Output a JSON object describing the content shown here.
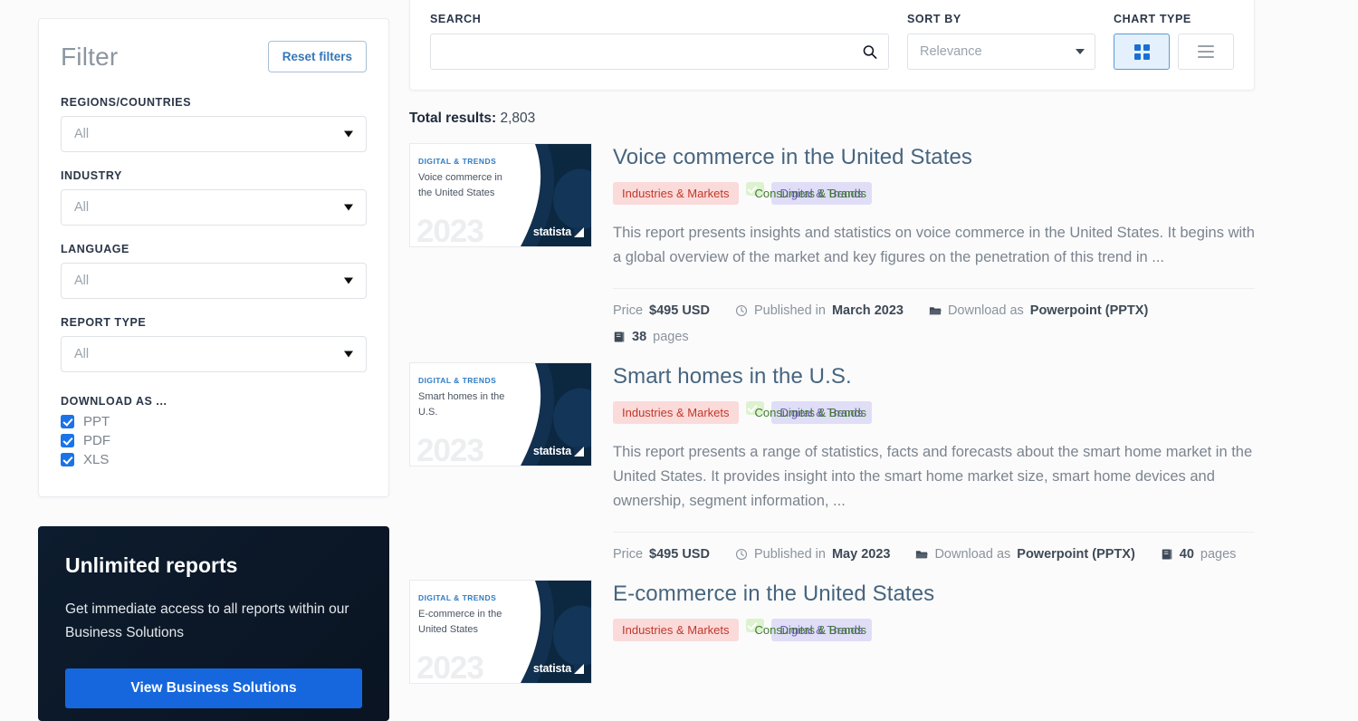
{
  "sidebar": {
    "filter_title": "Filter",
    "reset_label": "Reset filters",
    "groups": [
      {
        "label": "REGIONS/COUNTRIES",
        "value": "All"
      },
      {
        "label": "INDUSTRY",
        "value": "All"
      },
      {
        "label": "LANGUAGE",
        "value": "All"
      },
      {
        "label": "REPORT TYPE",
        "value": "All"
      }
    ],
    "download_as": {
      "title": "DOWNLOAD AS ...",
      "options": [
        {
          "label": "PPT",
          "checked": true
        },
        {
          "label": "PDF",
          "checked": true
        },
        {
          "label": "XLS",
          "checked": true
        }
      ]
    },
    "promo": {
      "title": "Unlimited reports",
      "text": "Get immediate access to all reports within our Business Solutions",
      "button": "View Business Solutions"
    }
  },
  "toolbar": {
    "search_label": "SEARCH",
    "search_value": "",
    "search_placeholder": "",
    "sort_label": "SORT BY",
    "sort_value": "Relevance",
    "chart_label": "CHART TYPE",
    "chart_grid_active": true
  },
  "results_header": {
    "prefix": "Total results:",
    "count": "2,803"
  },
  "results": [
    {
      "title": "Voice commerce in the United States",
      "thumb_kicker": "DIGITAL & TRENDS",
      "thumb_title": "Voice commerce in the United States",
      "thumb_year": "2023",
      "thumb_logo": "statista",
      "tags": [
        "Industries & Markets",
        "Consumers & Brands",
        "Digital & Trends"
      ],
      "description": "This report presents insights and statistics on voice commerce in the United States. It begins with a global overview of the market and key figures on the penetration of this trend in ...",
      "price_label": "Price",
      "price_value": "$495 USD",
      "published_label": "Published in",
      "published_value": "March 2023",
      "download_label": "Download as",
      "download_value": "Powerpoint (PPTX)",
      "pages_value": "38",
      "pages_label": "pages"
    },
    {
      "title": "Smart homes in the U.S.",
      "thumb_kicker": "DIGITAL & TRENDS",
      "thumb_title": "Smart homes in the U.S.",
      "thumb_year": "2023",
      "thumb_logo": "statista",
      "tags": [
        "Industries & Markets",
        "Consumers & Brands",
        "Digital & Trends"
      ],
      "description": "This report presents a range of statistics, facts and forecasts about the smart home market in the United States. It provides insight into the smart home market size, smart home devices and ownership, segment information, ...",
      "price_label": "Price",
      "price_value": "$495 USD",
      "published_label": "Published in",
      "published_value": "May 2023",
      "download_label": "Download as",
      "download_value": "Powerpoint (PPTX)",
      "pages_value": "40",
      "pages_label": "pages"
    },
    {
      "title": "E-commerce in the United States",
      "thumb_kicker": "DIGITAL & TRENDS",
      "thumb_title": "E-commerce in the United States",
      "thumb_year": "2023",
      "thumb_logo": "statista",
      "tags": [
        "Industries & Markets",
        "Consumers & Brands",
        "Digital & Trends"
      ],
      "description": "",
      "price_label": "",
      "price_value": "",
      "published_label": "",
      "published_value": "",
      "download_label": "",
      "download_value": "",
      "pages_value": "",
      "pages_label": ""
    }
  ],
  "colors": {
    "accent_blue": "#1a73e8",
    "title_slate": "#47657e",
    "tag_red_bg": "#fbdada",
    "tag_green_bg": "#ddf2cf",
    "tag_purple_bg": "#e0ddf7",
    "promo_dark": "#0d1c2e"
  }
}
